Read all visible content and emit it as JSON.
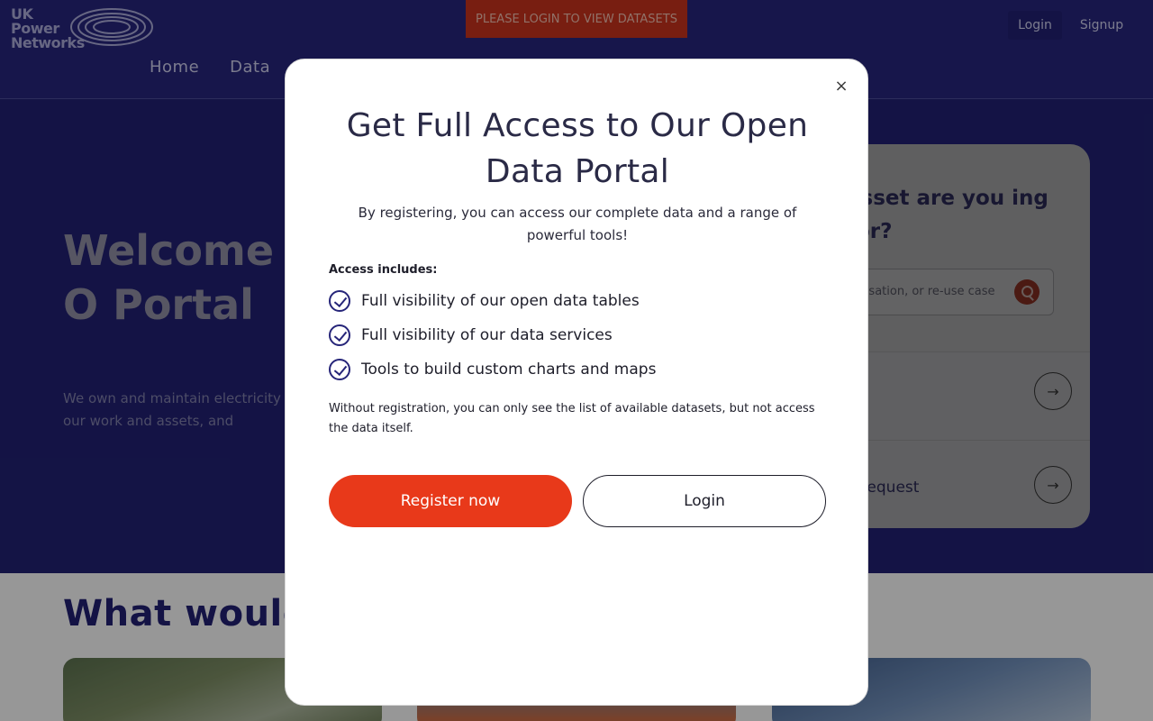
{
  "header": {
    "logo": {
      "line1": "UK",
      "line2": "Power",
      "line3": "Networks"
    },
    "nav": [
      {
        "label": "Home"
      },
      {
        "label": "Data"
      }
    ],
    "banner": "PLEASE LOGIN TO VIEW DATASETS",
    "login_label": "Login",
    "signup_label": "Signup"
  },
  "hero": {
    "title": "Welcome t Networks O Portal",
    "description": "We own and maintain electricity South East and East of England. behind our work and assets, and"
  },
  "search_card": {
    "heading": "asset are you ing for?",
    "search_text": "ualisation, or re-use case",
    "rows": [
      {
        "label": "s"
      },
      {
        "label": "a request"
      }
    ]
  },
  "section": {
    "title": "What would y"
  },
  "modal": {
    "close_symbol": "×",
    "title": "Get Full Access to Our Open Data Portal",
    "subtitle": "By registering, you can access our complete data and a range of powerful tools!",
    "access_heading": "Access includes:",
    "features": [
      {
        "label": "Full visibility of our open data tables"
      },
      {
        "label": "Full visibility of our data services"
      },
      {
        "label": "Tools to build custom charts and maps"
      }
    ],
    "note": "Without registration, you can only see the list of available datasets, but not access the data itself.",
    "register_label": "Register now",
    "login_label": "Login"
  },
  "colors": {
    "brand_navy": "#262579",
    "accent_orange": "#e8391a",
    "banner_red": "#c2311c"
  },
  "icons": {
    "close": "close-icon",
    "check": "check-circle-icon",
    "search": "search-icon",
    "arrow": "arrow-right-icon"
  }
}
